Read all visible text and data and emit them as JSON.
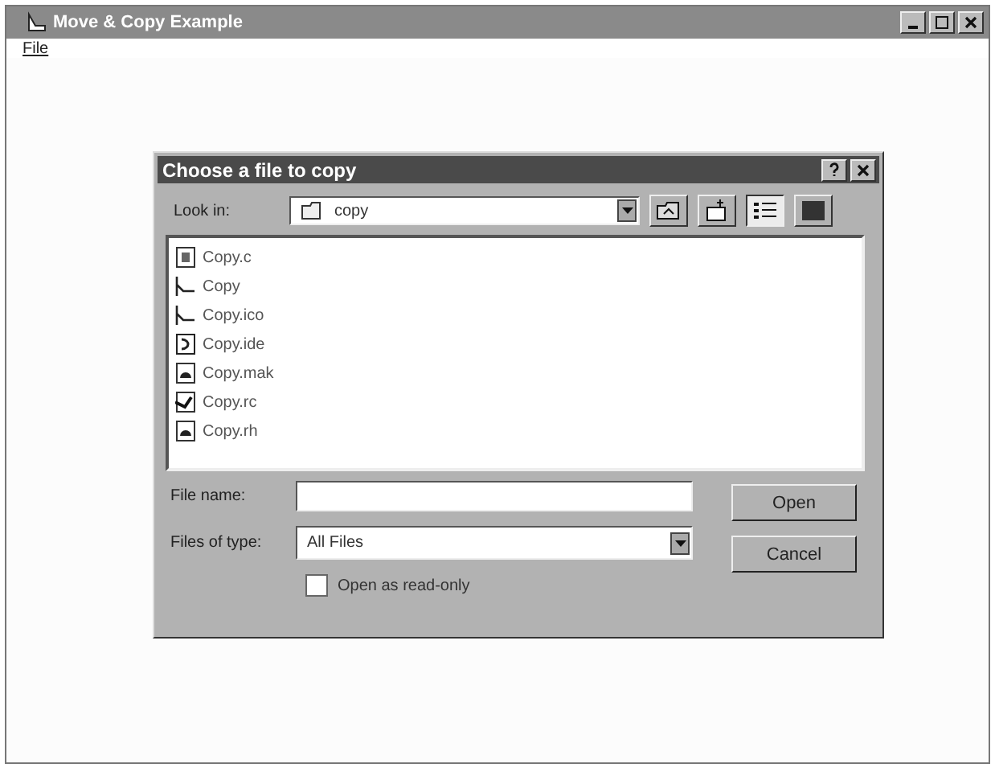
{
  "window": {
    "title": "Move & Copy Example",
    "menu": [
      "File"
    ]
  },
  "dialog": {
    "title": "Choose a file to copy",
    "look_in_label": "Look in:",
    "look_in_value": "copy",
    "toolbar": [
      {
        "kind": "up"
      },
      {
        "kind": "newfolder"
      },
      {
        "kind": "list",
        "selected": true
      },
      {
        "kind": "details",
        "selected": false
      }
    ],
    "files": [
      {
        "name": "Copy.c",
        "kind": "source"
      },
      {
        "name": "Copy",
        "kind": "project"
      },
      {
        "name": "Copy.ico",
        "kind": "project"
      },
      {
        "name": "Copy.ide",
        "kind": "ide"
      },
      {
        "name": "Copy.mak",
        "kind": "doc"
      },
      {
        "name": "Copy.rc",
        "kind": "resource"
      },
      {
        "name": "Copy.rh",
        "kind": "doc"
      }
    ],
    "file_name_label": "File name:",
    "files_of_type_label": "Files of type:",
    "files_of_type_value": "All Files",
    "read_only": {
      "label": "Open as read-only",
      "checked": false
    },
    "buttons": [
      "Open",
      "Cancel"
    ]
  }
}
